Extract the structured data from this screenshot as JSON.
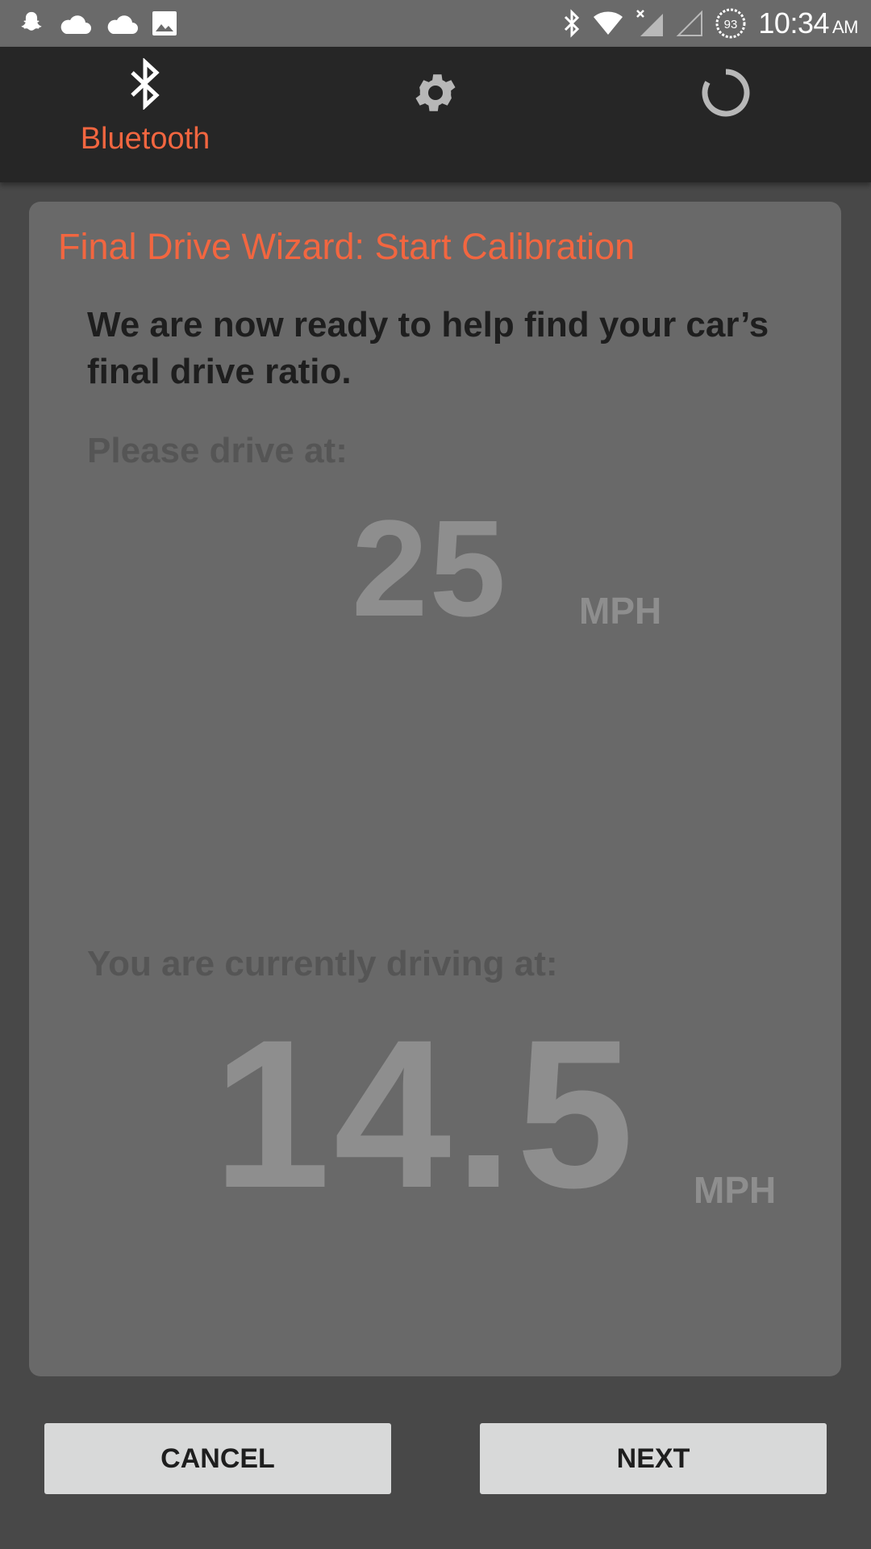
{
  "status_bar": {
    "left_icons": [
      "snapchat-icon",
      "cloud-icon",
      "cloud-icon",
      "image-icon"
    ],
    "right_icons": [
      "bluetooth-icon",
      "wifi-icon",
      "cell-signal-icon",
      "cell-signal-empty-icon",
      "battery-icon"
    ],
    "battery": "93",
    "time": "10:34",
    "ampm": "AM"
  },
  "top_bar": {
    "tabs": [
      {
        "icon": "bluetooth-icon",
        "label": "Bluetooth",
        "active": true
      },
      {
        "icon": "gear-icon",
        "label": ""
      },
      {
        "icon": "progress-ring-icon",
        "label": ""
      }
    ]
  },
  "card": {
    "title": "Final Drive Wizard: Start Calibration",
    "intro": "We are now ready to help find your car’s final drive ratio.",
    "target_label": "Please drive at:",
    "target_speed": "25",
    "target_unit": "MPH",
    "current_label": "You are currently driving at:",
    "current_speed": "14.5",
    "current_unit": "MPH"
  },
  "buttons": {
    "cancel": "CANCEL",
    "next": "NEXT"
  },
  "colors": {
    "accent": "#f26640",
    "toolbar": "#262626",
    "background": "#484848",
    "card": "#696969",
    "button": "#d8d9d9"
  }
}
